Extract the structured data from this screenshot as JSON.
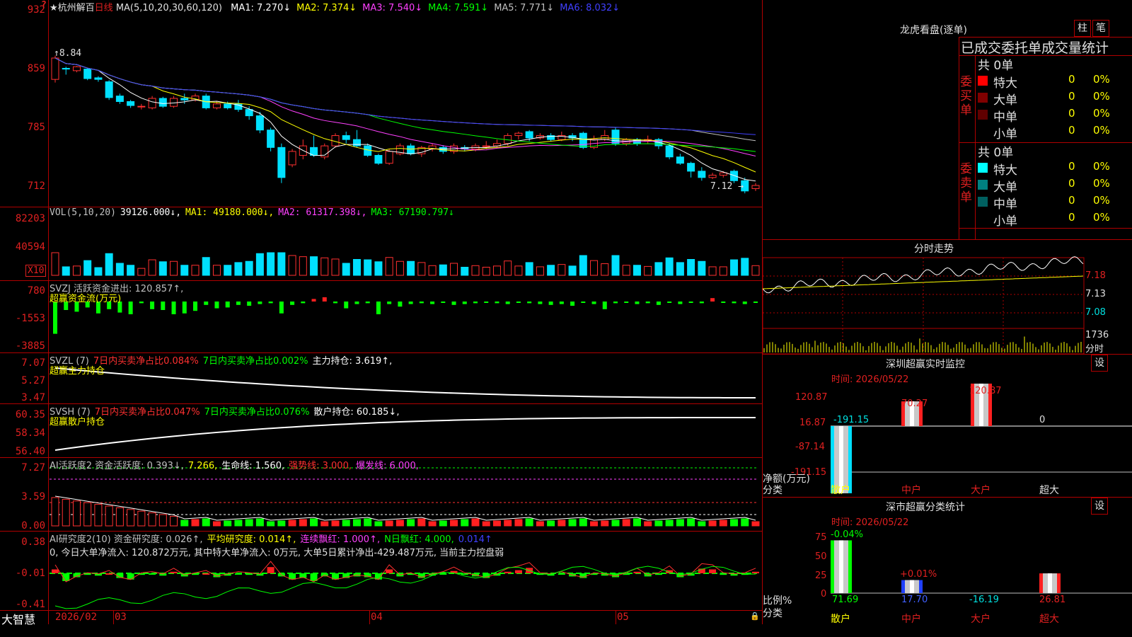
{
  "app": {
    "brand": "大智慧"
  },
  "main": {
    "price_ticks": [
      "932",
      "859",
      "785",
      "712"
    ],
    "header": {
      "stock": "★杭州解百",
      "period": "日线",
      "ma_def": "MA(5,10,20,30,60,120)",
      "ma": [
        {
          "label": "MA1: 7.270↓",
          "color": "#ffffff"
        },
        {
          "label": "MA2: 7.374↓",
          "color": "#ffff00"
        },
        {
          "label": "MA3: 7.540↓",
          "color": "#ff40ff"
        },
        {
          "label": "MA4: 7.591↓",
          "color": "#00ff00"
        },
        {
          "label": "MA5: 7.771↓",
          "color": "#c0c0c0"
        },
        {
          "label": "MA6: 8.032↓",
          "color": "#4040ff"
        }
      ]
    },
    "high_label": "8.84",
    "low_label": "7.12"
  },
  "vol": {
    "ticks": [
      "82203",
      "40594"
    ],
    "scale": "X10",
    "header": [
      {
        "label": "VOL(5,10,20)",
        "color": "#c0c0c0"
      },
      {
        "label": "39126.000↓,",
        "color": "#ffffff"
      },
      {
        "label": "MA1: 49180.000↓,",
        "color": "#ffff00"
      },
      {
        "label": "MA2: 61317.398↓,",
        "color": "#ff40ff"
      },
      {
        "label": "MA3: 67190.797↓",
        "color": "#00ff00"
      }
    ]
  },
  "svzj": {
    "ticks": [
      "780",
      "-1553",
      "-3885"
    ],
    "header": [
      {
        "label": "SVZJ  活跃资金进出: 120.857↑,",
        "color": "#c0c0c0"
      }
    ],
    "subtitle": "超赢资金流(万元)"
  },
  "svzl": {
    "ticks": [
      "7.07",
      "5.27",
      "3.47"
    ],
    "header": [
      {
        "label": "SVZL (7)",
        "color": "#c0c0c0"
      },
      {
        "label": "7日内买卖净占比0.084%",
        "color": "#ff3030"
      },
      {
        "label": "7日内买卖净占比0.002%",
        "color": "#00ff00"
      },
      {
        "label": "主力持仓: 3.619↑,",
        "color": "#ffffff"
      }
    ],
    "subtitle": "超赢主力持仓"
  },
  "svsh": {
    "ticks": [
      "60.35",
      "58.34",
      "56.40"
    ],
    "header": [
      {
        "label": "SVSH (7)",
        "color": "#c0c0c0"
      },
      {
        "label": "7日内买卖净占比0.047%",
        "color": "#ff3030"
      },
      {
        "label": "7日内买卖净占比0.076%",
        "color": "#00ff00"
      },
      {
        "label": "散户持仓: 60.185↓,",
        "color": "#ffffff"
      }
    ],
    "subtitle": "超赢散户持仓"
  },
  "ai1": {
    "ticks": [
      "7.27",
      "3.59",
      "0.00"
    ],
    "header": [
      {
        "label": "AI活跃度2 资金活跃度: 0.393↓,",
        "color": "#c0c0c0"
      },
      {
        "label": "7.266,",
        "color": "#ffff00"
      },
      {
        "label": "生命线: 1.560,",
        "color": "#ffffff"
      },
      {
        "label": "强势线: 3.000,",
        "color": "#ff3030"
      },
      {
        "label": "爆发线: 6.000,",
        "color": "#ff40ff"
      }
    ]
  },
  "ai2": {
    "ticks": [
      "0.38",
      "-0.01",
      "-0.41"
    ],
    "header": [
      {
        "label": "AI研究度2(10) 资金研究度: 0.026↑,",
        "color": "#c0c0c0"
      },
      {
        "label": "平均研究度: 0.014↑,",
        "color": "#ffff00"
      },
      {
        "label": "连续飘红: 1.000↑,",
        "color": "#ff40ff"
      },
      {
        "label": "N日飘红: 4.000,",
        "color": "#00ff00"
      },
      {
        "label": "0.014↑",
        "color": "#4040ff"
      }
    ],
    "line2": "0, 今日大单净流入: 120.872万元, 其中特大单净流入: 0万元, 大单5日累计净出-429.487万元, 当前主力控盘弱"
  },
  "timeaxis": {
    "labels": [
      "2026/02",
      "03",
      "04",
      "05"
    ]
  },
  "dragon": {
    "title": "龙虎看盘(逐单)",
    "btn_bar": "柱",
    "btn_pen": "笔",
    "tabs": "已成交委托单成交量统计",
    "buy": {
      "side": "委买单",
      "total": "共 0单",
      "rows": [
        {
          "name": "特大",
          "count": "0",
          "pct": "0%"
        },
        {
          "name": "大单",
          "count": "0",
          "pct": "0%"
        },
        {
          "name": "中单",
          "count": "0",
          "pct": "0%"
        },
        {
          "name": "小单",
          "count": "0",
          "pct": "0%"
        }
      ]
    },
    "sell": {
      "side": "委卖单",
      "total": "共 0单",
      "rows": [
        {
          "name": "特大",
          "count": "0",
          "pct": "0%"
        },
        {
          "name": "大单",
          "count": "0",
          "pct": "0%"
        },
        {
          "name": "中单",
          "count": "0",
          "pct": "0%"
        },
        {
          "name": "小单",
          "count": "0",
          "pct": "0%"
        }
      ]
    }
  },
  "intraday": {
    "title": "分时走势",
    "prices": [
      "7.18",
      "7.13",
      "7.08"
    ],
    "vol": "1736",
    "vol_label": "分时"
  },
  "monitor": {
    "title": "深圳超赢实时监控",
    "set": "设",
    "time": "时间: 2026/05/22",
    "ticks": [
      "120.87",
      "16.87",
      "-87.14",
      "-191.15"
    ],
    "net_label": "净额(万元)",
    "cat_label": "分类",
    "bars": [
      {
        "name": "散户",
        "value": "-191.15"
      },
      {
        "name": "中户",
        "value": "70.27"
      },
      {
        "name": "大户",
        "value": "120.87"
      },
      {
        "name": "超大",
        "value": "0"
      }
    ]
  },
  "classify": {
    "title": "深市超赢分类统计",
    "set": "设",
    "time": "时间: 2026/05/22",
    "ticks": [
      "75",
      "50",
      "25",
      "0"
    ],
    "ratio_label": "比例%",
    "cat_label": "分类",
    "bars": [
      {
        "name": "散户",
        "top": "-0.04%",
        "bottom": "71.69"
      },
      {
        "name": "中户",
        "top": "+0.01%",
        "bottom": "17.70"
      },
      {
        "name": "大户",
        "top": "",
        "bottom": "-16.19"
      },
      {
        "name": "超大",
        "top": "",
        "bottom": "26.81"
      }
    ]
  },
  "candles": [
    [
      846,
      873,
      842,
      876
    ],
    [
      860,
      859,
      852,
      862
    ],
    [
      857,
      862,
      855,
      863
    ],
    [
      859,
      847,
      845,
      860
    ],
    [
      848,
      846,
      843,
      850
    ],
    [
      843,
      823,
      820,
      845
    ],
    [
      825,
      818,
      815,
      828
    ],
    [
      818,
      813,
      810,
      820
    ],
    [
      812,
      812,
      808,
      815
    ],
    [
      810,
      822,
      808,
      825
    ],
    [
      822,
      812,
      810,
      824
    ],
    [
      812,
      822,
      810,
      825
    ],
    [
      822,
      820,
      815,
      828
    ],
    [
      820,
      825,
      818,
      828
    ],
    [
      825,
      810,
      808,
      828
    ],
    [
      810,
      815,
      808,
      818
    ],
    [
      815,
      810,
      808,
      818
    ],
    [
      815,
      808,
      805,
      820
    ],
    [
      808,
      800,
      795,
      812
    ],
    [
      800,
      782,
      778,
      805
    ],
    [
      782,
      760,
      755,
      785
    ],
    [
      760,
      722,
      715,
      765
    ],
    [
      738,
      755,
      735,
      758
    ],
    [
      750,
      762,
      745,
      770
    ],
    [
      760,
      750,
      748,
      775
    ],
    [
      748,
      762,
      745,
      765
    ],
    [
      762,
      775,
      760,
      778
    ],
    [
      775,
      770,
      765,
      780
    ],
    [
      770,
      762,
      760,
      782
    ],
    [
      762,
      750,
      748,
      765
    ],
    [
      750,
      740,
      738,
      752
    ],
    [
      740,
      755,
      738,
      758
    ],
    [
      752,
      762,
      750,
      765
    ],
    [
      762,
      752,
      750,
      765
    ],
    [
      752,
      760,
      748,
      762
    ],
    [
      758,
      762,
      755,
      765
    ],
    [
      760,
      755,
      752,
      763
    ],
    [
      755,
      762,
      752,
      765
    ],
    [
      760,
      758,
      755,
      763
    ],
    [
      758,
      762,
      755,
      765
    ],
    [
      762,
      762,
      758,
      768
    ],
    [
      762,
      765,
      760,
      770
    ],
    [
      765,
      775,
      762,
      778
    ],
    [
      775,
      778,
      770,
      780
    ],
    [
      780,
      772,
      768,
      782
    ],
    [
      772,
      775,
      770,
      778
    ],
    [
      775,
      770,
      768,
      778
    ],
    [
      770,
      775,
      768,
      780
    ],
    [
      775,
      772,
      768,
      778
    ],
    [
      778,
      760,
      758,
      780
    ],
    [
      760,
      770,
      758,
      775
    ],
    [
      770,
      775,
      768,
      782
    ],
    [
      782,
      765,
      762,
      785
    ],
    [
      765,
      770,
      762,
      772
    ],
    [
      770,
      765,
      762,
      772
    ],
    [
      768,
      770,
      765,
      775
    ],
    [
      770,
      762,
      758,
      772
    ],
    [
      762,
      748,
      745,
      765
    ],
    [
      748,
      740,
      738,
      752
    ],
    [
      740,
      730,
      722,
      742
    ],
    [
      730,
      722,
      718,
      735
    ],
    [
      722,
      725,
      720,
      728
    ],
    [
      725,
      728,
      722,
      730
    ],
    [
      730,
      718,
      715,
      732
    ],
    [
      718,
      705,
      702,
      722
    ],
    [
      708,
      712,
      705,
      715
    ]
  ],
  "flow": [
    -3800,
    -1000,
    -1200,
    -700,
    -1400,
    -900,
    -1300,
    -1500,
    -200,
    -900,
    -1000,
    -1500,
    -1400,
    -1100,
    -400,
    -800,
    -700,
    -400,
    -500,
    -300,
    -200,
    -1400,
    -400,
    -200,
    300,
    500,
    -200,
    -800,
    -300,
    -200,
    -1500,
    -300,
    -600,
    -300,
    -200,
    -300,
    -100,
    -400,
    -300,
    -200,
    -100,
    -200,
    -300,
    -100,
    -200,
    -300,
    -400,
    -300,
    -500,
    -100,
    -300,
    -900,
    -200,
    -100,
    -300,
    -200,
    -400,
    -100,
    -300,
    -100,
    -200,
    400,
    -100,
    -200,
    -300,
    -100,
    -200
  ],
  "ai2vals": [
    0.05,
    -0.1,
    -0.05,
    -0.02,
    -0.03,
    0.0,
    -0.06,
    -0.08,
    -0.02,
    -0.01,
    -0.03,
    0.02,
    -0.04,
    -0.02,
    0.0,
    -0.05,
    -0.03,
    -0.01,
    -0.02,
    -0.03,
    0.08,
    -0.04,
    -0.08,
    -0.06,
    -0.1,
    -0.04,
    -0.08,
    -0.06,
    -0.04,
    -0.05,
    -0.08,
    0.05,
    -0.04,
    -0.02,
    -0.06,
    -0.03,
    -0.01,
    0.03,
    -0.02,
    -0.04,
    -0.06,
    -0.03,
    0.02,
    0.04,
    0.07,
    -0.02,
    -0.03,
    -0.01,
    -0.04,
    -0.06,
    -0.02,
    -0.03,
    -0.05,
    -0.02,
    0.02,
    -0.04,
    -0.02,
    0.04,
    -0.05,
    -0.03,
    0.06,
    0.05,
    -0.02,
    -0.03,
    -0.02,
    0.02,
    0.03
  ]
}
